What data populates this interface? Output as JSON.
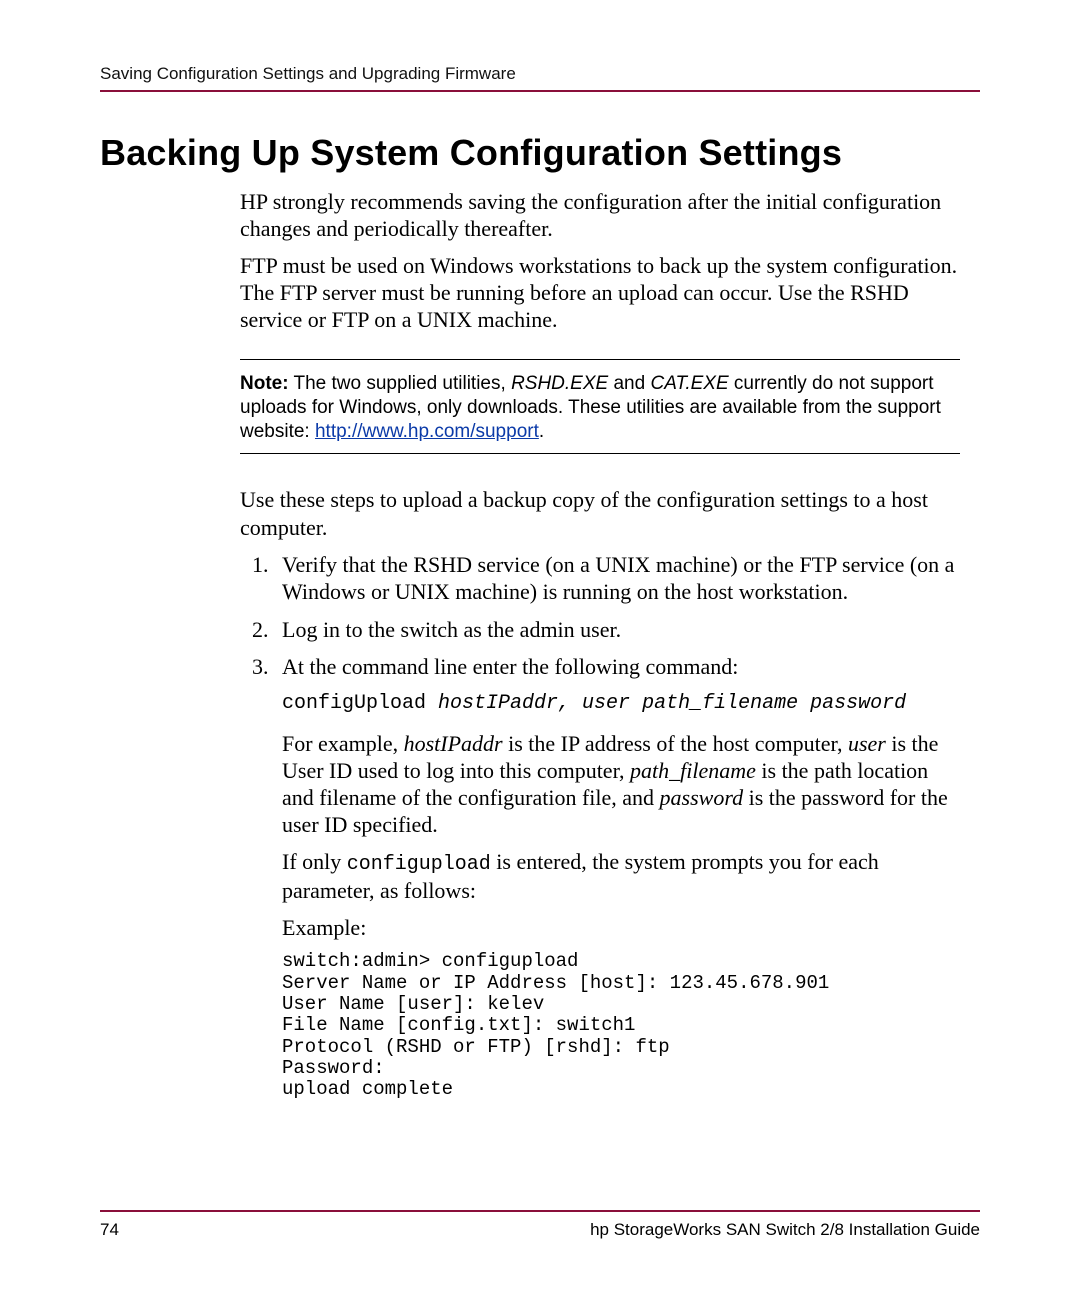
{
  "header": {
    "running_head": "Saving Configuration Settings and Upgrading Firmware"
  },
  "title": "Backing Up System Configuration Settings",
  "paragraphs": {
    "intro1": "HP strongly recommends saving the configuration after the initial configuration changes and periodically thereafter.",
    "intro2": "FTP must be used on Windows workstations to back up the system configuration. The FTP server must be running before an upload can occur. Use the RSHD service or FTP on a UNIX machine."
  },
  "note": {
    "label": "Note:",
    "pre": "  The two supplied utilities, ",
    "util1": "RSHD.EXE",
    "mid1": " and ",
    "util2": "CAT.EXE",
    "post": " currently do not support uploads for Windows, only downloads. These utilities are available from the support website: ",
    "link_text": "http://www.hp.com/support",
    "period": "."
  },
  "steps_intro": "Use these steps to upload a backup copy of the configuration settings to a host computer.",
  "steps": {
    "s1": "Verify that the RSHD service (on a UNIX machine) or the FTP service (on a Windows or UNIX machine) is running on the host workstation.",
    "s2": "Log in to the switch as the admin user.",
    "s3_lead": "At the command line enter the following command:",
    "cmd_head": "configUpload ",
    "cmd_args": "hostIPaddr, user path_filename password",
    "expl_pre": "For example, ",
    "expl_hostip": "hostIPaddr",
    "expl_mid1": " is the IP address of the host computer, ",
    "expl_user": "user",
    "expl_mid2": " is the User ID used to log into this computer, ",
    "expl_path": "path_filename",
    "expl_mid3": " is the path location and filename of the configuration file, and ",
    "expl_pwd": "password",
    "expl_tail": " is the password for the user ID specified.",
    "ifonly_pre": "If only ",
    "ifonly_cmd": "configupload",
    "ifonly_post": " is entered, the system prompts you for each parameter, as follows:",
    "example_label": "Example:",
    "example_block": "switch:admin> configupload\nServer Name or IP Address [host]: 123.45.678.901\nUser Name [user]: kelev\nFile Name [config.txt]: switch1\nProtocol (RSHD or FTP) [rshd]: ftp\nPassword:\nupload complete"
  },
  "footer": {
    "page_number": "74",
    "doc_title": "hp StorageWorks SAN Switch 2/8 Installation Guide"
  }
}
